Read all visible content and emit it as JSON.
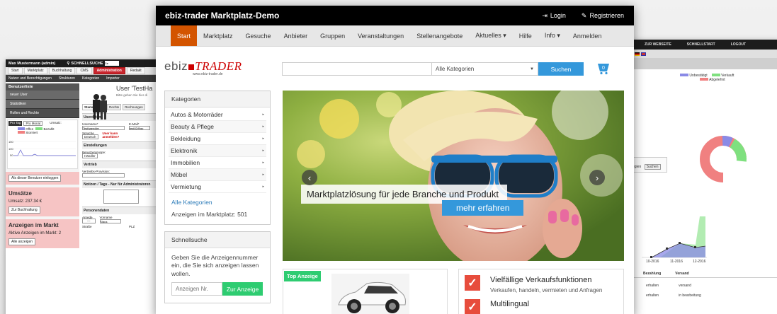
{
  "left_window": {
    "user": "Max Mustermann (admin)",
    "quicksearch": "SCHNELLSUCHE",
    "tabs": [
      "Start",
      "Marktplatz",
      "Buchhaltung",
      "CMS",
      "Administration",
      "Redakt"
    ],
    "subnav": [
      "Nutzer und Berechtigungen",
      "Strukturen",
      "Kategorien",
      "Importer"
    ],
    "side_header": "Benutzerliste",
    "side_items": [
      "neuer User",
      "Statistiken",
      "Rollen und Rechte"
    ],
    "chart_tabs": [
      "Pro Tag",
      "Pro Monat"
    ],
    "chart_title": "Umsatz:",
    "legend": [
      "Offen",
      "Bezahlt",
      "Storniert"
    ],
    "login_as": "Als dieser Benutzer einloggen",
    "sales_title": "Umsätze",
    "sales_text": "Umsatz: 237.34 €",
    "sales_btn": "Zur Buchhaltung",
    "market_title": "Anzeigen im Markt",
    "market_text": "Aktive Anzeigen im Markt: 2",
    "market_btn": "Alle anzeigen",
    "user_title": "User 'TestHa",
    "user_hint": "Bitte geben Sie hier di",
    "user_tabs": [
      "Stammdaten",
      "Rechte",
      "Rechnungen"
    ],
    "section_user": "Userdaten",
    "username_label": "Username*",
    "username_value": "Testhaendler",
    "email_label": "E-Mail*",
    "email_value": "test02@go",
    "lang_label": "Sprache",
    "lang_value": "Deutsch",
    "settings": "Einstellungen",
    "group_label": "Benutzergruppe:",
    "group_value": "Händler",
    "sales_label": "Vertrieb",
    "commission_label": "Vertriebs-Provision:",
    "notes_label": "Notizen / Tags - Nur für Administratoren",
    "personal": "Personendaten",
    "salutation": "Anrede",
    "first_name": "Vorname",
    "first_value": "Klaus",
    "street": "Straße",
    "zip": "PLZ",
    "warn": "User kann anmelden?"
  },
  "right_window": {
    "links": [
      "ZUR WEBSEITE",
      "SCHNELLSTART",
      "LOGOUT"
    ],
    "legend": [
      "Unbestätigt",
      "Verkauft",
      "Abgelehnt"
    ],
    "search_btn": "Suchen",
    "axis": [
      "10-2016",
      "11-2016",
      "12-2016"
    ],
    "cols": [
      "Bezahlung",
      "Versand"
    ],
    "rows": [
      [
        "erhalten",
        "versand"
      ],
      [
        "erhalten",
        "in bearbeitung"
      ]
    ],
    "stray": [
      "egien"
    ]
  },
  "main": {
    "title": "ebiz-trader Marktplatz-Demo",
    "login": "Login",
    "register": "Registrieren",
    "nav": [
      "Start",
      "Marktplatz",
      "Gesuche",
      "Anbieter",
      "Gruppen",
      "Veranstaltungen",
      "Stellenangebote",
      "Aktuelles ▾",
      "Hilfe",
      "Info ▾",
      "Anmelden"
    ],
    "logo_a": "ebiz",
    "logo_b": "TRADER",
    "logo_url": "www.ebiz-trader.de",
    "search_placeholder": "",
    "category_select": "Alle Kategorien",
    "search_btn": "Suchen",
    "categories_title": "Kategorien",
    "categories": [
      "Autos & Motorräder",
      "Beauty & Pflege",
      "Bekleidung",
      "Elektronik",
      "Immobilien",
      "Möbel",
      "Vermietung"
    ],
    "all_categories": "Alle Kategorien",
    "ad_count": "Anzeigen im Marktplatz: 501",
    "quicksearch_title": "Schnellsuche",
    "quicksearch_text": "Geben Sie die Anzeigennummer ein, die Sie sich anzeigen lassen wollen.",
    "ad_no_placeholder": "Anzeigen Nr.",
    "ad_btn": "Zur Anzeige",
    "hero_caption": "Marktplatzlösung für jede Branche und Produkt",
    "hero_btn": "mehr erfahren",
    "top_ad": "Top Anzeige",
    "features": [
      {
        "title": "Vielfällige Verkaufsfunktionen",
        "text": "Verkaufen, handeln, vermieten und Anfragen"
      },
      {
        "title": "Multilingual",
        "text": ""
      }
    ]
  },
  "colors": {
    "accent": "#d35400",
    "blue": "#3498db",
    "green": "#2ecc71",
    "red": "#e74c3c"
  }
}
